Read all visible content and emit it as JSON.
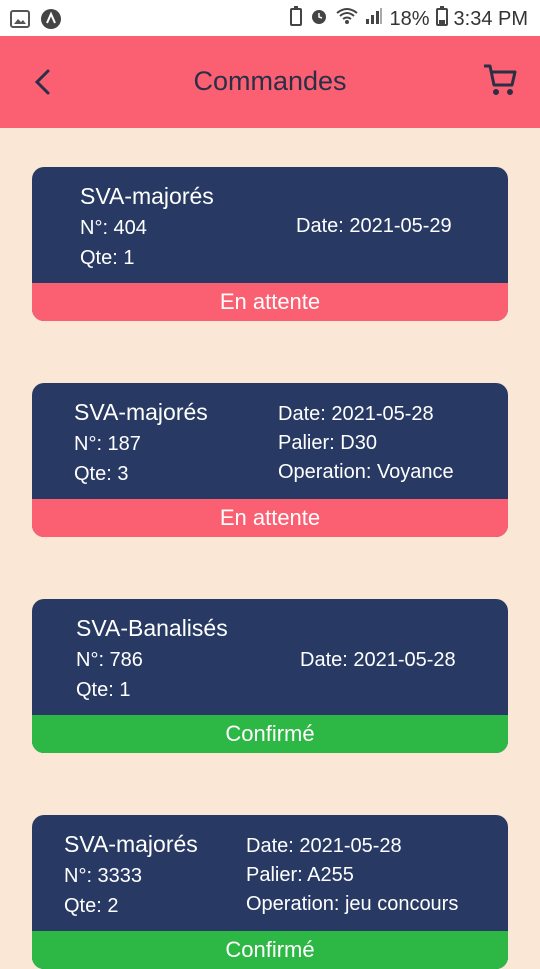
{
  "status_bar": {
    "battery": "18%",
    "time": "3:34 PM"
  },
  "header": {
    "title": "Commandes"
  },
  "orders": [
    {
      "name": "SVA-majorés",
      "number": "N°: 404",
      "qty": "Qte: 1",
      "date": "Date: 2021-05-29",
      "status": "En attente"
    },
    {
      "name": "SVA-majorés",
      "number": "N°: 187",
      "qty": "Qte: 3",
      "date": "Date: 2021-05-28",
      "palier": "Palier: D30",
      "operation": "Operation: Voyance",
      "status": "En attente"
    },
    {
      "name": "SVA-Banalisés",
      "number": "N°: 786",
      "qty": "Qte: 1",
      "date": "Date: 2021-05-28",
      "status": "Confirmé"
    },
    {
      "name": "SVA-majorés",
      "number": "N°: 3333",
      "qty": "Qte: 2",
      "date": "Date: 2021-05-28",
      "palier": "Palier: A255",
      "operation": "Operation: jeu concours",
      "status": "Confirmé"
    }
  ],
  "colors": {
    "header": "#fb6072",
    "card": "#283a63",
    "pending": "#fb6072",
    "confirmed": "#2db744",
    "background": "#fbe7d6"
  }
}
